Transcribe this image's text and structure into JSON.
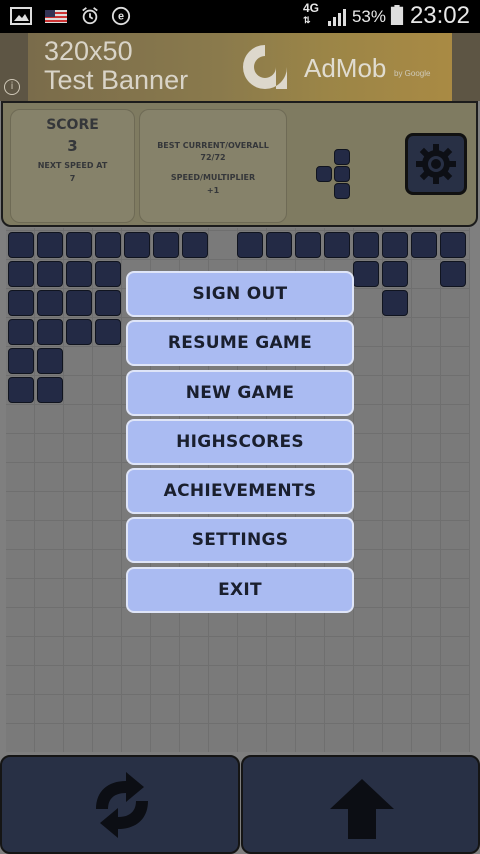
{
  "status_bar": {
    "icons_left": [
      "image-icon",
      "us-flag-icon",
      "alarm-icon",
      "e-app-icon"
    ],
    "network": "4G",
    "battery_percent": "53%",
    "time": "23:02"
  },
  "ad_banner": {
    "title": "320x50\nTest Banner",
    "brand": "AdMob",
    "brand_sub": "by Google",
    "info": "i"
  },
  "score_panel": {
    "score_label": "SCORE",
    "score_value": "3",
    "next_speed_label": "NEXT SPEED AT",
    "next_speed_value": "7"
  },
  "best_panel": {
    "best_label": "BEST CURRENT/OVERALL",
    "best_value": "72/72",
    "speed_label": "SPEED/MULTIPLIER",
    "speed_value": "+1"
  },
  "settings_icon": "gear-icon",
  "menu": {
    "items": [
      "SIGN OUT",
      "RESUME GAME",
      "NEW GAME",
      "HIGHSCORES",
      "ACHIEVEMENTS",
      "SETTINGS",
      "EXIT"
    ]
  },
  "controls": {
    "left_icon": "rotate-arrows-icon",
    "right_icon": "up-arrow-icon"
  },
  "colors": {
    "block": "#232a45",
    "menu_button": "#aabbf2",
    "board": "#7a7a7a",
    "header": "#7f7b61"
  }
}
